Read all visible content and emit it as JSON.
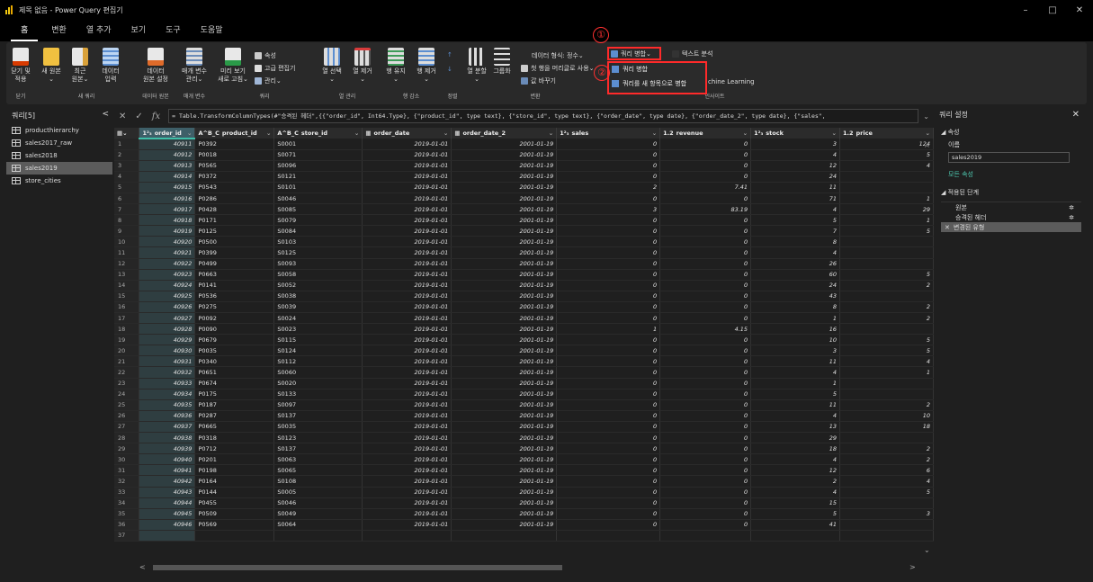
{
  "window": {
    "title": "제목 없음 - Power Query 편집기",
    "min": "–",
    "max": "□",
    "close": "✕"
  },
  "tabs": [
    "홈",
    "변환",
    "열 추가",
    "보기",
    "도구",
    "도움말"
  ],
  "ribbon": {
    "close_apply": "닫기 및\n적용",
    "new_source": "새 원본\n⌄",
    "recent": "최근\n원본⌄",
    "enter_data": "데이터\n입력",
    "group_new_query": "새 쿼리",
    "group_close": "닫기",
    "ds_settings": "데이터\n원본 설정",
    "group_ds": "데이터 원본",
    "params": "매개 변수\n관리⌄",
    "group_params": "매개 변수",
    "preview": "미리 보기\n새로 고침⌄",
    "props": "속성",
    "adv_editor": "고급 편집기",
    "manage": "관리⌄",
    "group_query": "쿼리",
    "choose_cols": "열 선택\n⌄",
    "remove_cols": "열 제거\n⌄",
    "group_cols": "열 관리",
    "keep_rows": "행 유지\n⌄",
    "remove_rows": "행 제거\n⌄",
    "group_rows": "행 감소",
    "group_sort": "정렬",
    "split": "열 분할\n⌄",
    "groupby": "그룹화",
    "dtype": "데이터 형식: 정수⌄",
    "first_row_header": "첫 행을 머리글로 사용⌄",
    "replace": "값 바꾸기",
    "group_transform": "변환",
    "merge_queries": "쿼리 병합⌄",
    "text_analytics": "텍스트 분석",
    "ml": "chine Learning",
    "group_insights": "인사이트",
    "menu_merge": "쿼리 병합",
    "menu_merge_new": "쿼리를 새 항목으로 병합",
    "anno1": "①",
    "anno2": "②"
  },
  "queries": {
    "header": "쿼리[5]",
    "collapse": "<",
    "items": [
      "producthierarchy",
      "sales2017_raw",
      "sales2018",
      "sales2019",
      "store_cities"
    ],
    "selected": 3
  },
  "formula": {
    "text": "= Table.TransformColumnTypes(#\"승격된 헤더\",{{\"order_id\", Int64.Type}, {\"product_id\", type text}, {\"store_id\", type text}, {\"order_date\", type date}, {\"order_date_2\", type date}, {\"sales\",",
    "cancel": "✕",
    "ok": "✓",
    "fx": "fx"
  },
  "grid": {
    "columns": [
      {
        "type": "1²₃",
        "name": "order_id"
      },
      {
        "type": "A^B_C",
        "name": "product_id"
      },
      {
        "type": "A^B_C",
        "name": "store_id"
      },
      {
        "type": "▦",
        "name": "order_date"
      },
      {
        "type": "▦",
        "name": "order_date_2"
      },
      {
        "type": "1²₃",
        "name": "sales"
      },
      {
        "type": "1.2",
        "name": "revenue"
      },
      {
        "type": "1²₃",
        "name": "stock"
      },
      {
        "type": "1.2",
        "name": "price"
      }
    ],
    "rows": [
      [
        "1",
        "40911",
        "P0392",
        "S0001",
        "2019-01-01",
        "2001-01-19",
        "0",
        "0",
        "3",
        "124"
      ],
      [
        "2",
        "40912",
        "P0018",
        "S0071",
        "2019-01-01",
        "2001-01-19",
        "0",
        "0",
        "4",
        "5"
      ],
      [
        "3",
        "40913",
        "P0565",
        "S0096",
        "2019-01-01",
        "2001-01-19",
        "0",
        "0",
        "12",
        "4"
      ],
      [
        "4",
        "40914",
        "P0372",
        "S0121",
        "2019-01-01",
        "2001-01-19",
        "0",
        "0",
        "24",
        ""
      ],
      [
        "5",
        "40915",
        "P0543",
        "S0101",
        "2019-01-01",
        "2001-01-19",
        "2",
        "7.41",
        "11",
        ""
      ],
      [
        "6",
        "40916",
        "P0286",
        "S0046",
        "2019-01-01",
        "2001-01-19",
        "0",
        "0",
        "71",
        "1"
      ],
      [
        "7",
        "40917",
        "P0428",
        "S0085",
        "2019-01-01",
        "2001-01-19",
        "3",
        "83.19",
        "4",
        "29"
      ],
      [
        "8",
        "40918",
        "P0171",
        "S0079",
        "2019-01-01",
        "2001-01-19",
        "0",
        "0",
        "5",
        "1"
      ],
      [
        "9",
        "40919",
        "P0125",
        "S0084",
        "2019-01-01",
        "2001-01-19",
        "0",
        "0",
        "7",
        "5"
      ],
      [
        "10",
        "40920",
        "P0500",
        "S0103",
        "2019-01-01",
        "2001-01-19",
        "0",
        "0",
        "8",
        ""
      ],
      [
        "11",
        "40921",
        "P0399",
        "S0125",
        "2019-01-01",
        "2001-01-19",
        "0",
        "0",
        "4",
        ""
      ],
      [
        "12",
        "40922",
        "P0499",
        "S0093",
        "2019-01-01",
        "2001-01-19",
        "0",
        "0",
        "26",
        ""
      ],
      [
        "13",
        "40923",
        "P0663",
        "S0058",
        "2019-01-01",
        "2001-01-19",
        "0",
        "0",
        "60",
        "5"
      ],
      [
        "14",
        "40924",
        "P0141",
        "S0052",
        "2019-01-01",
        "2001-01-19",
        "0",
        "0",
        "24",
        "2"
      ],
      [
        "15",
        "40925",
        "P0536",
        "S0038",
        "2019-01-01",
        "2001-01-19",
        "0",
        "0",
        "43",
        ""
      ],
      [
        "16",
        "40926",
        "P0275",
        "S0039",
        "2019-01-01",
        "2001-01-19",
        "0",
        "0",
        "8",
        "2"
      ],
      [
        "17",
        "40927",
        "P0092",
        "S0024",
        "2019-01-01",
        "2001-01-19",
        "0",
        "0",
        "1",
        "2"
      ],
      [
        "18",
        "40928",
        "P0090",
        "S0023",
        "2019-01-01",
        "2001-01-19",
        "1",
        "4.15",
        "16",
        ""
      ],
      [
        "19",
        "40929",
        "P0679",
        "S0115",
        "2019-01-01",
        "2001-01-19",
        "0",
        "0",
        "10",
        "5"
      ],
      [
        "20",
        "40930",
        "P0035",
        "S0124",
        "2019-01-01",
        "2001-01-19",
        "0",
        "0",
        "3",
        "5"
      ],
      [
        "21",
        "40931",
        "P0340",
        "S0112",
        "2019-01-01",
        "2001-01-19",
        "0",
        "0",
        "11",
        "4"
      ],
      [
        "22",
        "40932",
        "P0651",
        "S0060",
        "2019-01-01",
        "2001-01-19",
        "0",
        "0",
        "4",
        "1"
      ],
      [
        "23",
        "40933",
        "P0674",
        "S0020",
        "2019-01-01",
        "2001-01-19",
        "0",
        "0",
        "1",
        ""
      ],
      [
        "24",
        "40934",
        "P0175",
        "S0133",
        "2019-01-01",
        "2001-01-19",
        "0",
        "0",
        "5",
        ""
      ],
      [
        "25",
        "40935",
        "P0187",
        "S0097",
        "2019-01-01",
        "2001-01-19",
        "0",
        "0",
        "11",
        "2"
      ],
      [
        "26",
        "40936",
        "P0287",
        "S0137",
        "2019-01-01",
        "2001-01-19",
        "0",
        "0",
        "4",
        "10"
      ],
      [
        "27",
        "40937",
        "P0665",
        "S0035",
        "2019-01-01",
        "2001-01-19",
        "0",
        "0",
        "13",
        "18"
      ],
      [
        "28",
        "40938",
        "P0318",
        "S0123",
        "2019-01-01",
        "2001-01-19",
        "0",
        "0",
        "29",
        ""
      ],
      [
        "29",
        "40939",
        "P0712",
        "S0137",
        "2019-01-01",
        "2001-01-19",
        "0",
        "0",
        "18",
        "2"
      ],
      [
        "30",
        "40940",
        "P0201",
        "S0063",
        "2019-01-01",
        "2001-01-19",
        "0",
        "0",
        "4",
        "2"
      ],
      [
        "31",
        "40941",
        "P0198",
        "S0065",
        "2019-01-01",
        "2001-01-19",
        "0",
        "0",
        "12",
        "6"
      ],
      [
        "32",
        "40942",
        "P0164",
        "S0108",
        "2019-01-01",
        "2001-01-19",
        "0",
        "0",
        "2",
        "4"
      ],
      [
        "33",
        "40943",
        "P0144",
        "S0005",
        "2019-01-01",
        "2001-01-19",
        "0",
        "0",
        "4",
        "5"
      ],
      [
        "34",
        "40944",
        "P0455",
        "S0046",
        "2019-01-01",
        "2001-01-19",
        "0",
        "0",
        "15",
        ""
      ],
      [
        "35",
        "40945",
        "P0509",
        "S0049",
        "2019-01-01",
        "2001-01-19",
        "0",
        "0",
        "5",
        "3"
      ],
      [
        "36",
        "40946",
        "P0569",
        "S0064",
        "2019-01-01",
        "2001-01-19",
        "0",
        "0",
        "41",
        ""
      ],
      [
        "37",
        "",
        "",
        "",
        "",
        "",
        "",
        "",
        "",
        ""
      ]
    ]
  },
  "settings": {
    "title": "쿼리 설정",
    "close": "✕",
    "props": "◢ 속성",
    "name_label": "이름",
    "name_value": "sales2019",
    "all_props": "모든 속성",
    "steps_title": "◢ 적용된 단계",
    "steps": [
      "원본",
      "승격된 헤더",
      "변경된 유형"
    ],
    "gear": "✲",
    "step_x": "✕"
  },
  "colors": {
    "accent": "#3fbfa8",
    "annotation": "#ff2a2a",
    "selected": "#5b5b5b"
  }
}
